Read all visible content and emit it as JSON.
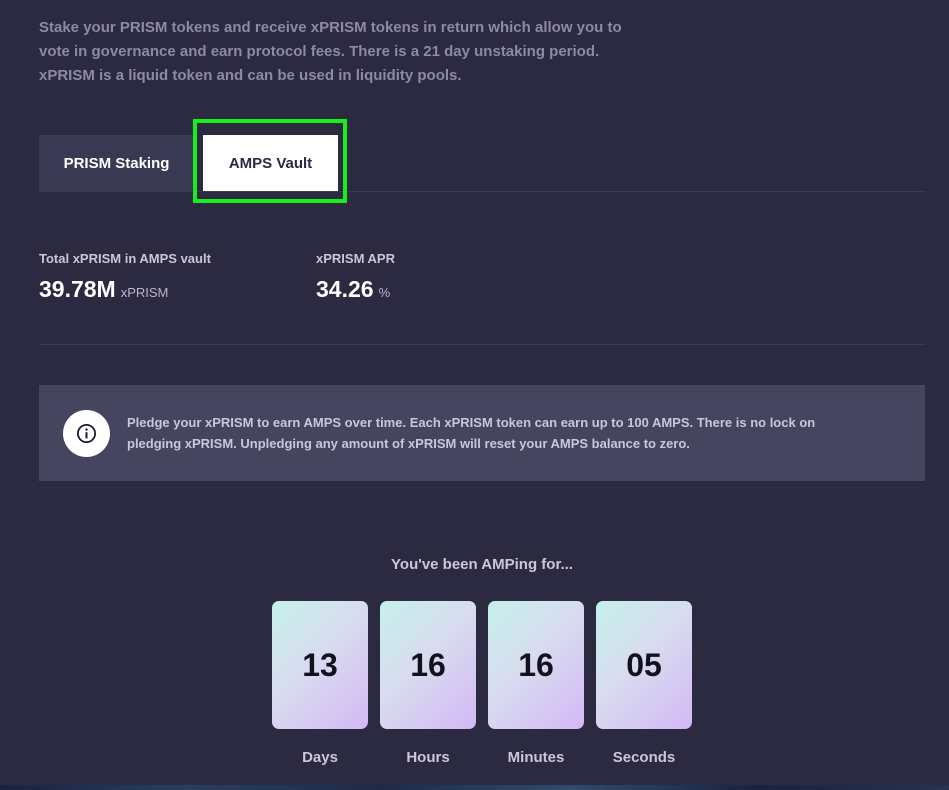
{
  "intro": {
    "text": "Stake your PRISM tokens and receive xPRISM tokens in return which allow you to vote in governance and earn protocol fees. There is a 21 day unstaking period. xPRISM is a liquid token and can be used in liquidity pools."
  },
  "tabs": [
    {
      "label": "PRISM Staking",
      "active": false
    },
    {
      "label": "AMPS Vault",
      "active": true
    }
  ],
  "stats": {
    "total_label": "Total xPRISM in AMPS vault",
    "total_value": "39.78M",
    "total_unit": "xPRISM",
    "apr_label": "xPRISM APR",
    "apr_value": "34.26",
    "apr_unit": "%"
  },
  "info": {
    "icon": "info-icon",
    "text": "Pledge your xPRISM to earn AMPS over time. Each xPRISM token can earn up to 100 AMPS. There is no lock on pledging xPRISM. Unpledging any amount of xPRISM will reset your AMPS balance to zero."
  },
  "timer": {
    "title": "You've been AMPing for...",
    "units": [
      {
        "value": "13",
        "label": "Days"
      },
      {
        "value": "16",
        "label": "Hours"
      },
      {
        "value": "16",
        "label": "Minutes"
      },
      {
        "value": "05",
        "label": "Seconds"
      }
    ]
  },
  "colors": {
    "background": "#2b2a40",
    "highlight": "#19ee1d",
    "active_tab": "#ffffff",
    "inactive_tab": "#3a3953",
    "info_box": "#464560"
  }
}
